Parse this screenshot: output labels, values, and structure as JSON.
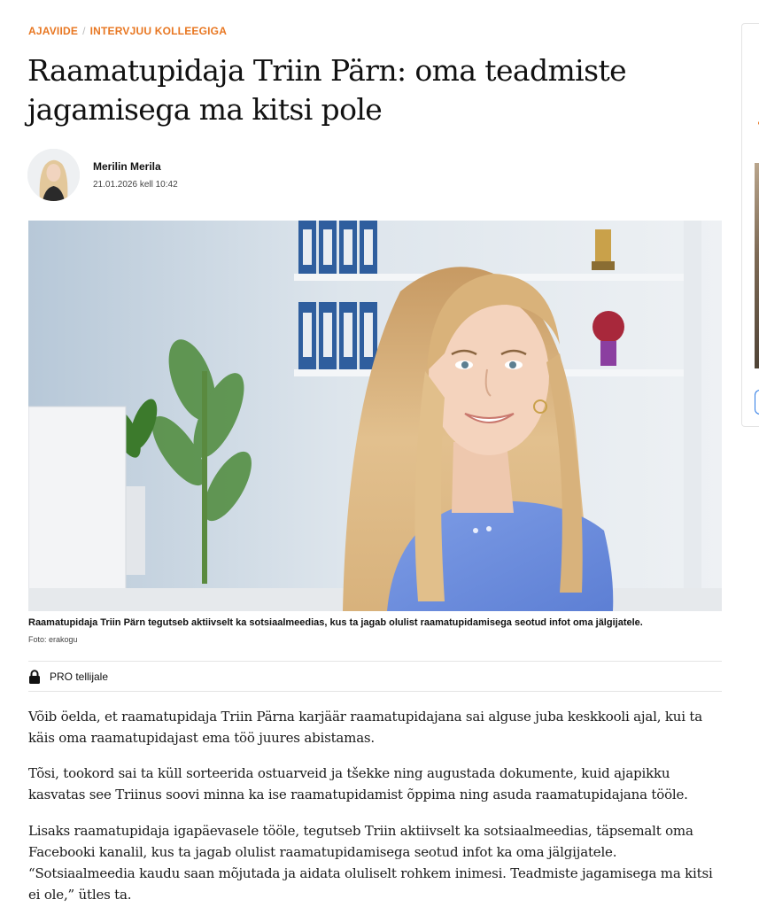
{
  "breadcrumb": {
    "section": "AJAVIIDE",
    "separator": "/",
    "subsection": "INTERVJUU KOLLEEGIGA"
  },
  "article": {
    "title": "Raamatupidaja Triin Pärn: oma teadmiste jagamisega ma kitsi pole",
    "author": "Merilin Merila",
    "date": "21.01.2026 kell 10:42",
    "image_caption": "Raamatupidaja Triin Pärn tegutseb aktiivselt ka sotsiaalmeedias, kus ta jagab olulist raamatupidamisega seotud infot oma jälgijatele.",
    "image_credit": "Foto: erakogu",
    "access_label": "PRO tellijale",
    "paragraphs": [
      "Võib öelda, et raamatupidaja Triin Pärna karjäär raamatupidajana sai alguse juba keskkooli ajal, kui ta käis oma raamatupidajast ema töö juures abistamas.",
      "Tõsi, tookord sai ta küll sorteerida ostuarveid ja tšekke ning augustada dokumente, kuid ajapikku kasvatas see Triinus soovi minna ka ise raamatupidamist õppima ning asuda raamatupidajana tööle.",
      "Lisaks raamatupidaja igapäevasele tööle, tegutseb Triin aktiivselt ka sotsiaalmeedias, täpsemalt oma Facebooki kanalil, kus ta jagab olulist raamatupidamisega seotud infot ka oma jälgijatele. “Sotsiaalmeedia kaudu saan mõjutada ja aidata oluliselt rohkem inimesi. Teadmiste jagamisega ma kitsi ei ole,” ütles ta."
    ]
  },
  "icons": {
    "lock": "lock-icon"
  },
  "colors": {
    "accent": "#e87722",
    "text": "#111111",
    "divider": "#e4e4e4"
  }
}
